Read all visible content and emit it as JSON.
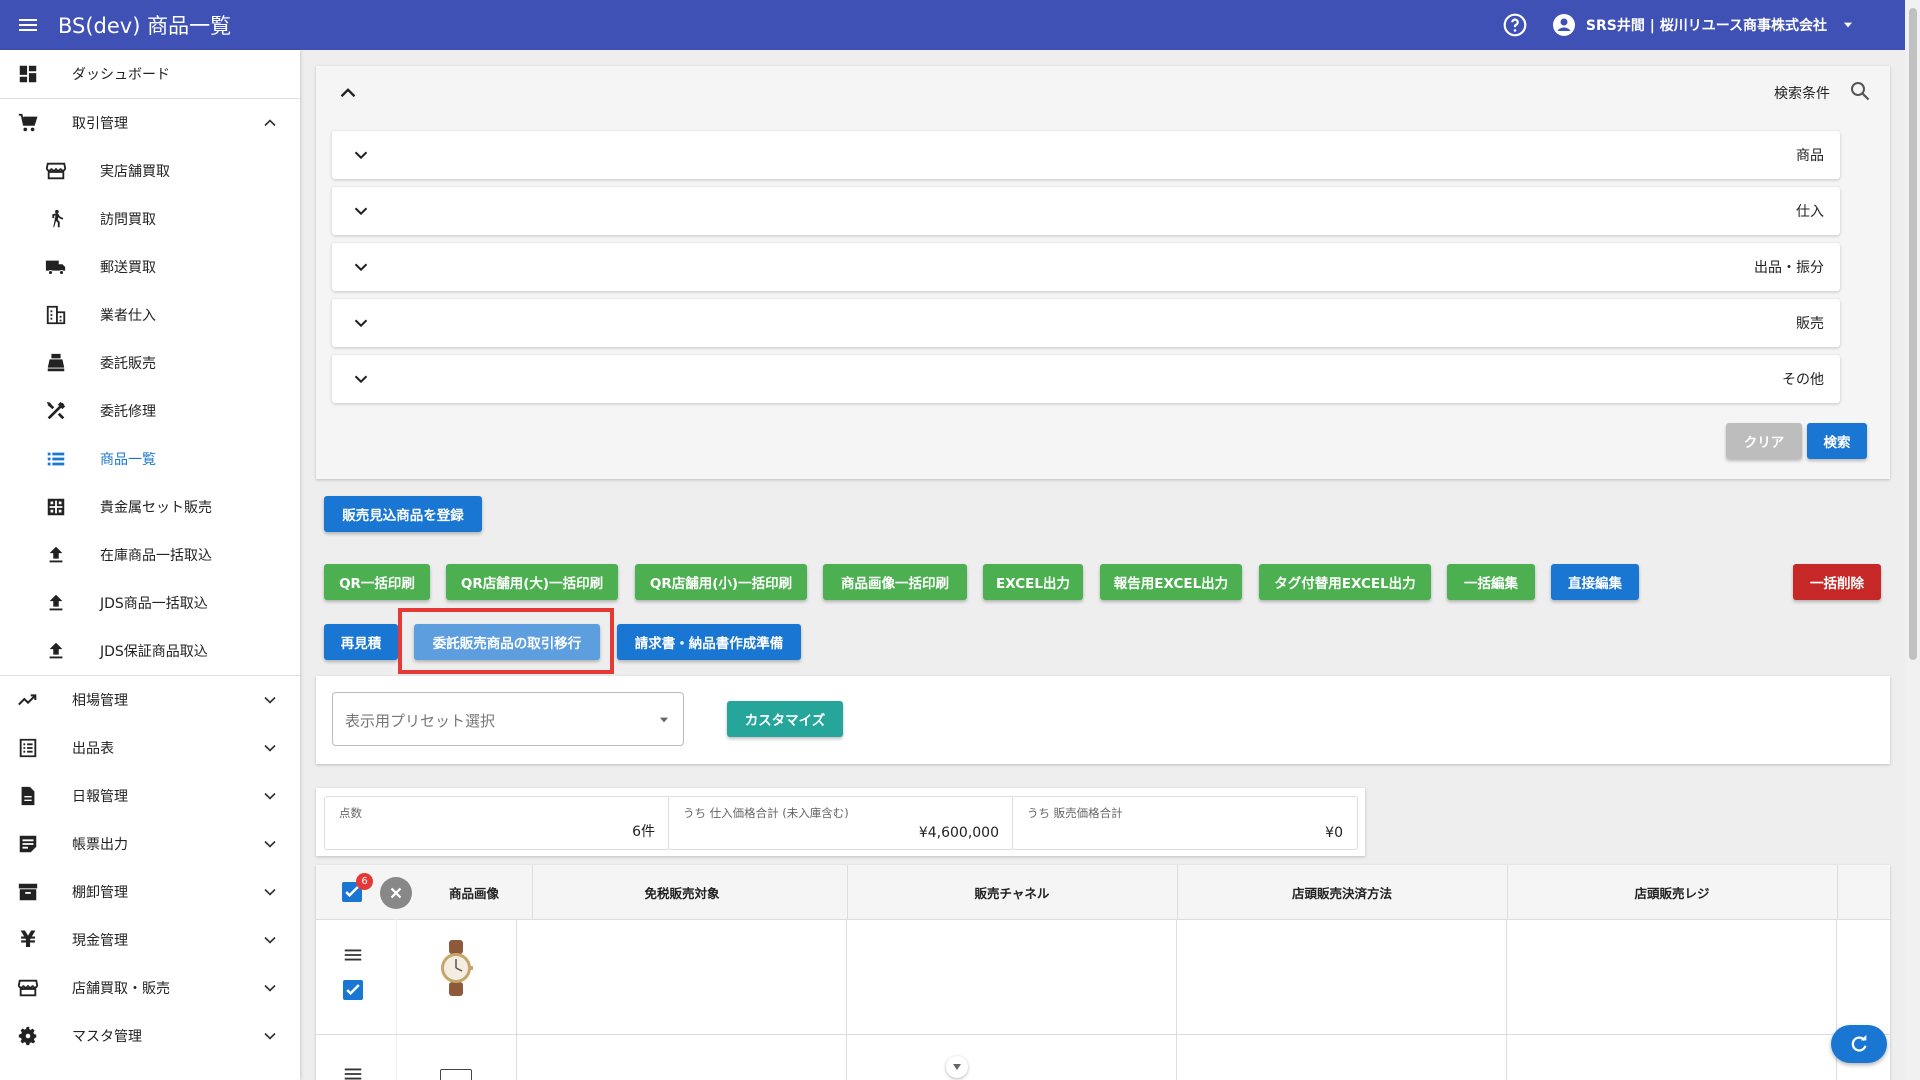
{
  "app": {
    "title": "BS(dev) 商品一覧",
    "user": "SRS井間 | 桜川リユース商事株式会社"
  },
  "sidebar": {
    "items": [
      {
        "label": "ダッシュボード",
        "icon": "dashboard-icon"
      },
      {
        "label": "取引管理",
        "icon": "cart-icon",
        "expanded": true
      },
      {
        "label": "実店舗買取",
        "icon": "store-icon"
      },
      {
        "label": "訪問買取",
        "icon": "walk-icon"
      },
      {
        "label": "郵送買取",
        "icon": "truck-icon"
      },
      {
        "label": "業者仕入",
        "icon": "building-icon"
      },
      {
        "label": "委託販売",
        "icon": "register-icon"
      },
      {
        "label": "委託修理",
        "icon": "tools-icon"
      },
      {
        "label": "商品一覧",
        "icon": "list-icon",
        "active": true
      },
      {
        "label": "貴金属セット販売",
        "icon": "grid-icon"
      },
      {
        "label": "在庫商品一括取込",
        "icon": "upload-icon"
      },
      {
        "label": "JDS商品一括取込",
        "icon": "upload-icon"
      },
      {
        "label": "JDS保証商品取込",
        "icon": "upload-icon"
      },
      {
        "label": "相場管理",
        "icon": "trend-icon"
      },
      {
        "label": "出品表",
        "icon": "sheet-icon"
      },
      {
        "label": "日報管理",
        "icon": "file-icon"
      },
      {
        "label": "帳票出力",
        "icon": "note-icon"
      },
      {
        "label": "棚卸管理",
        "icon": "archive-icon"
      },
      {
        "label": "現金管理",
        "icon": "yen-icon"
      },
      {
        "label": "店舗買取・販売",
        "icon": "shop-icon"
      },
      {
        "label": "マスタ管理",
        "icon": "gear-icon"
      }
    ]
  },
  "search": {
    "title": "検索条件",
    "sections": [
      "商品",
      "仕入",
      "出品・振分",
      "販売",
      "その他"
    ],
    "clear_label": "クリア",
    "search_label": "検索"
  },
  "actions": {
    "register_label": "販売見込商品を登録",
    "row1": [
      "QR一括印刷",
      "QR店舗用(大)一括印刷",
      "QR店舗用(小)一括印刷",
      "商品画像一括印刷",
      "EXCEL出力",
      "報告用EXCEL出力",
      "タグ付替用EXCEL出力",
      "一括編集",
      "直接編集"
    ],
    "delete_label": "一括削除",
    "row2": [
      "再見積",
      "委託販売商品の取引移行",
      "請求書・納品書作成準備"
    ]
  },
  "preset": {
    "placeholder": "表示用プリセット選択",
    "customize_label": "カスタマイズ"
  },
  "stats": [
    {
      "label": "点数",
      "value": "6件"
    },
    {
      "label": "うち 仕入価格合計 (未入庫含む)",
      "value": "¥4,600,000"
    },
    {
      "label": "うち 販売価格合計",
      "value": "¥0"
    }
  ],
  "table": {
    "badge": "6",
    "columns": [
      "商品画像",
      "免税販売対象",
      "販売チャネル",
      "店頭販売決済方法",
      "店頭販売レジ"
    ]
  },
  "colors": {
    "appbar": "#3f51b5",
    "green": "#4caf50",
    "blue": "#1976d2",
    "red": "#c62828",
    "teal": "#26a69a",
    "highlight": "#e53935"
  }
}
